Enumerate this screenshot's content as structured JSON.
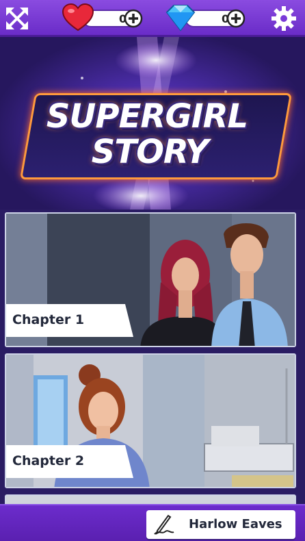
{
  "header": {
    "hearts_count": "0",
    "gems_count": "0",
    "icons": [
      "fullscreen-icon",
      "heart-icon",
      "diamond-icon",
      "plus-icon",
      "gear-icon"
    ]
  },
  "hero": {
    "title_line1": "SUPERGIRL",
    "title_line2": "STORY"
  },
  "chapters": [
    {
      "label": "Chapter 1"
    },
    {
      "label": "Chapter 2"
    }
  ],
  "footer": {
    "player_name": "Harlow Eaves"
  },
  "colors": {
    "topbar": "#7a3ad8",
    "accent_orange": "#ff9a3c",
    "heart": "#e8283a",
    "gem": "#4fc3f7"
  }
}
